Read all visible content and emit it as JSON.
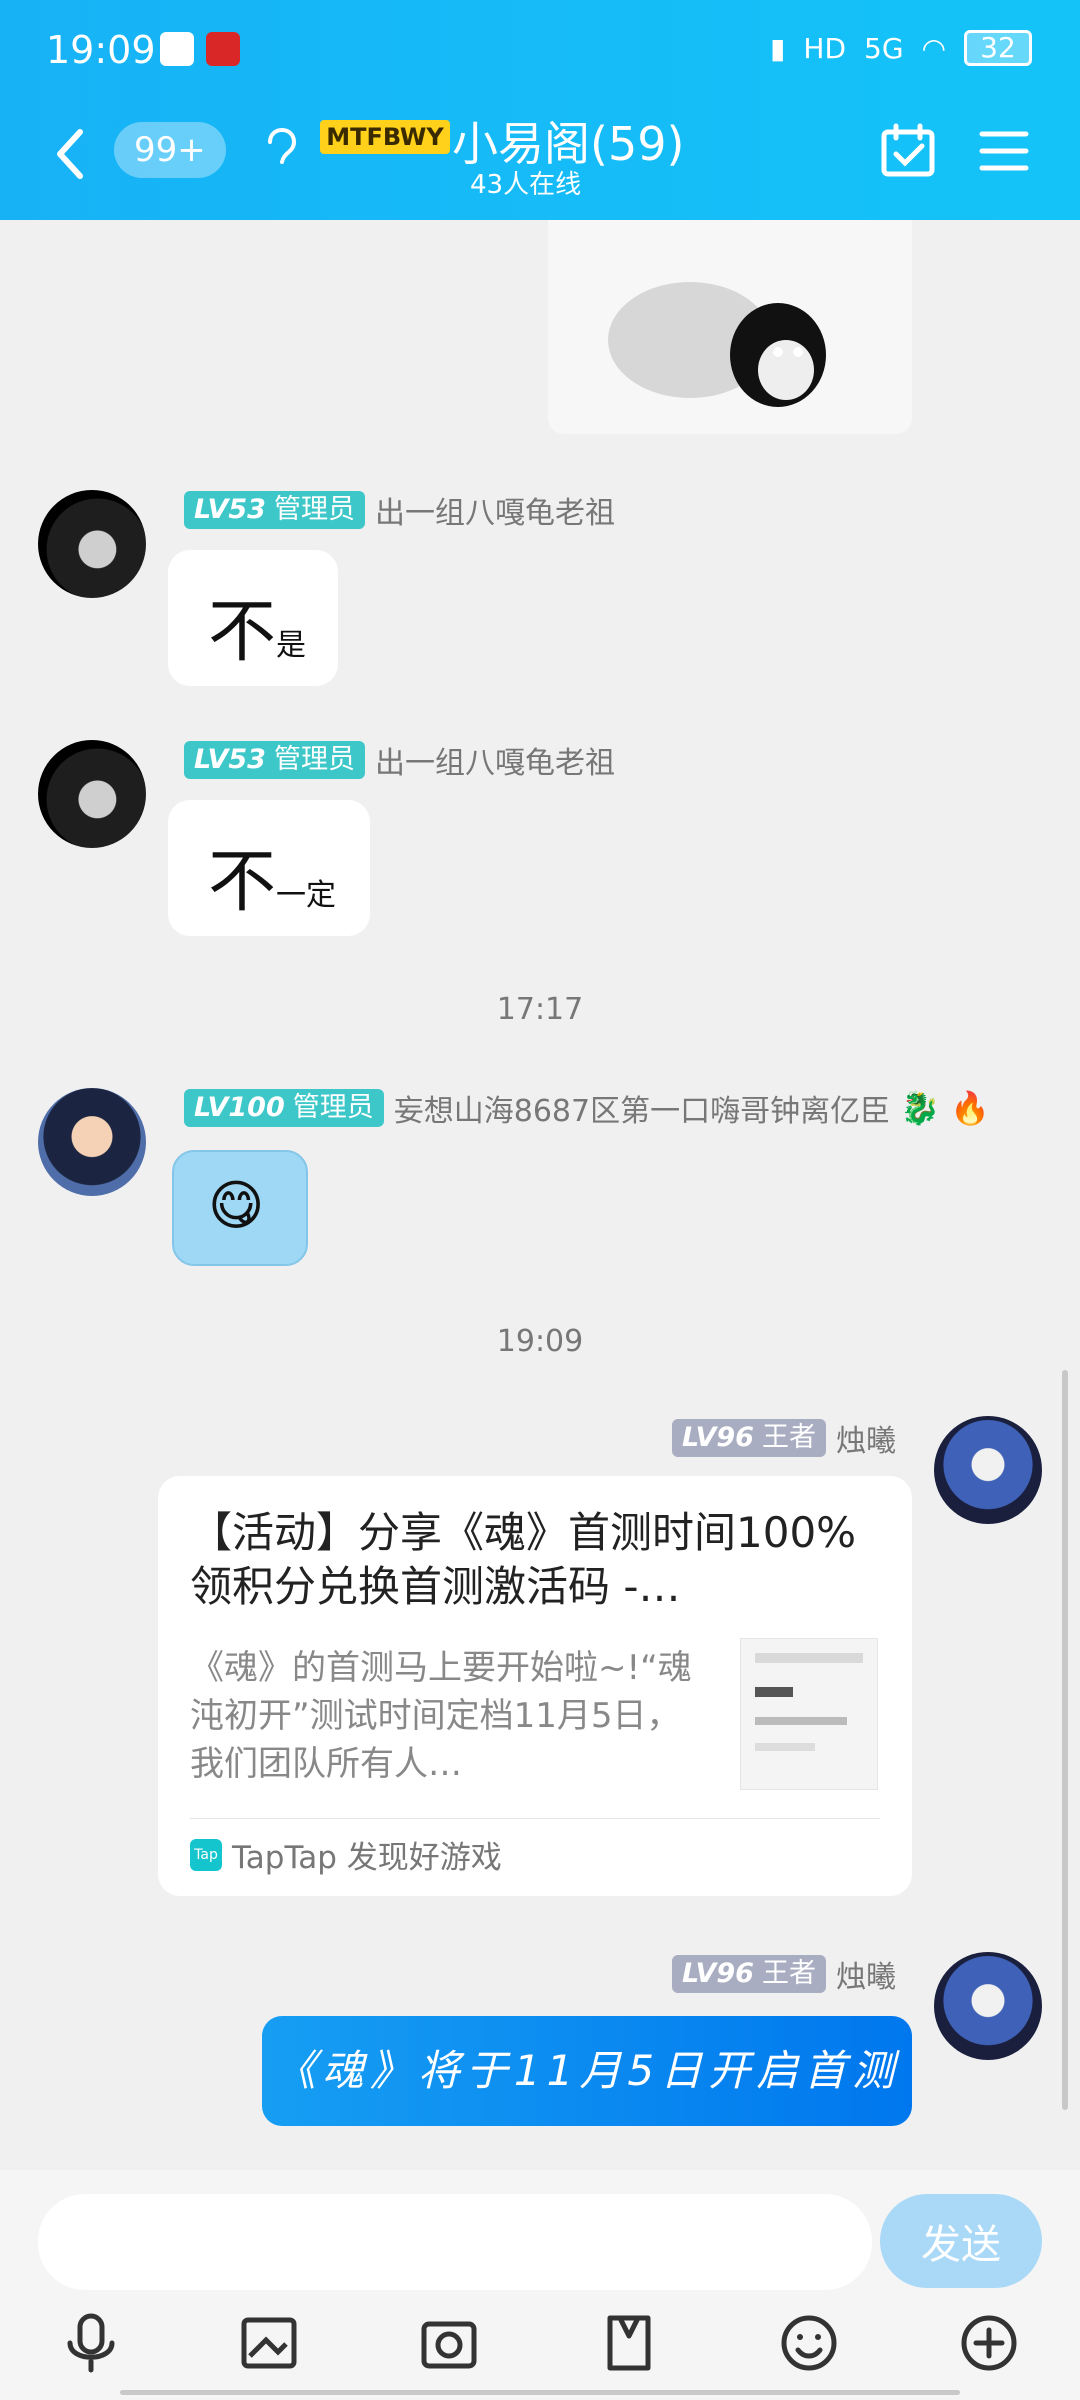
{
  "status": {
    "time": "19:09",
    "hd": "HD",
    "network": "5G",
    "battery": "32"
  },
  "header": {
    "unread": "99+",
    "group_badge": "MTFBWY",
    "title": "小易阁(59)",
    "online": "43人在线"
  },
  "messages": [
    {
      "level": "LV53",
      "role": "管理员",
      "name": "出一组八嘎龟老祖",
      "big": "不",
      "small": "是"
    },
    {
      "level": "LV53",
      "role": "管理员",
      "name": "出一组八嘎龟老祖",
      "big": "不",
      "small": "一定"
    },
    {
      "level": "LV100",
      "role": "管理员",
      "name": "妄想山海8687区第一口嗨哥钟离亿臣"
    },
    {
      "level": "LV96",
      "role": "王者",
      "name": "烛曦"
    },
    {
      "level": "LV96",
      "role": "王者",
      "name": "烛曦"
    }
  ],
  "timestamps": [
    "17:17",
    "19:09"
  ],
  "share_card": {
    "title": "【活动】分享《魂》首测时间100%领积分兑换首测激活码 -…",
    "description": "《魂》的首测马上要开始啦~!“魂沌初开”测试时间定档11月5日，我们团队所有人…",
    "source": "TapTap 发现好游戏",
    "logo_text": "Tap"
  },
  "blue_message": "《魂》将于11月5日开启首测",
  "input": {
    "placeholder": "",
    "send_label": "发送"
  },
  "colors": {
    "header": "#17b2f6",
    "level_admin": "#3dc7c9",
    "level_king": "#a9adc1",
    "send_button": "#a9d9f7",
    "blue_bubble": "#0a8bf0"
  }
}
